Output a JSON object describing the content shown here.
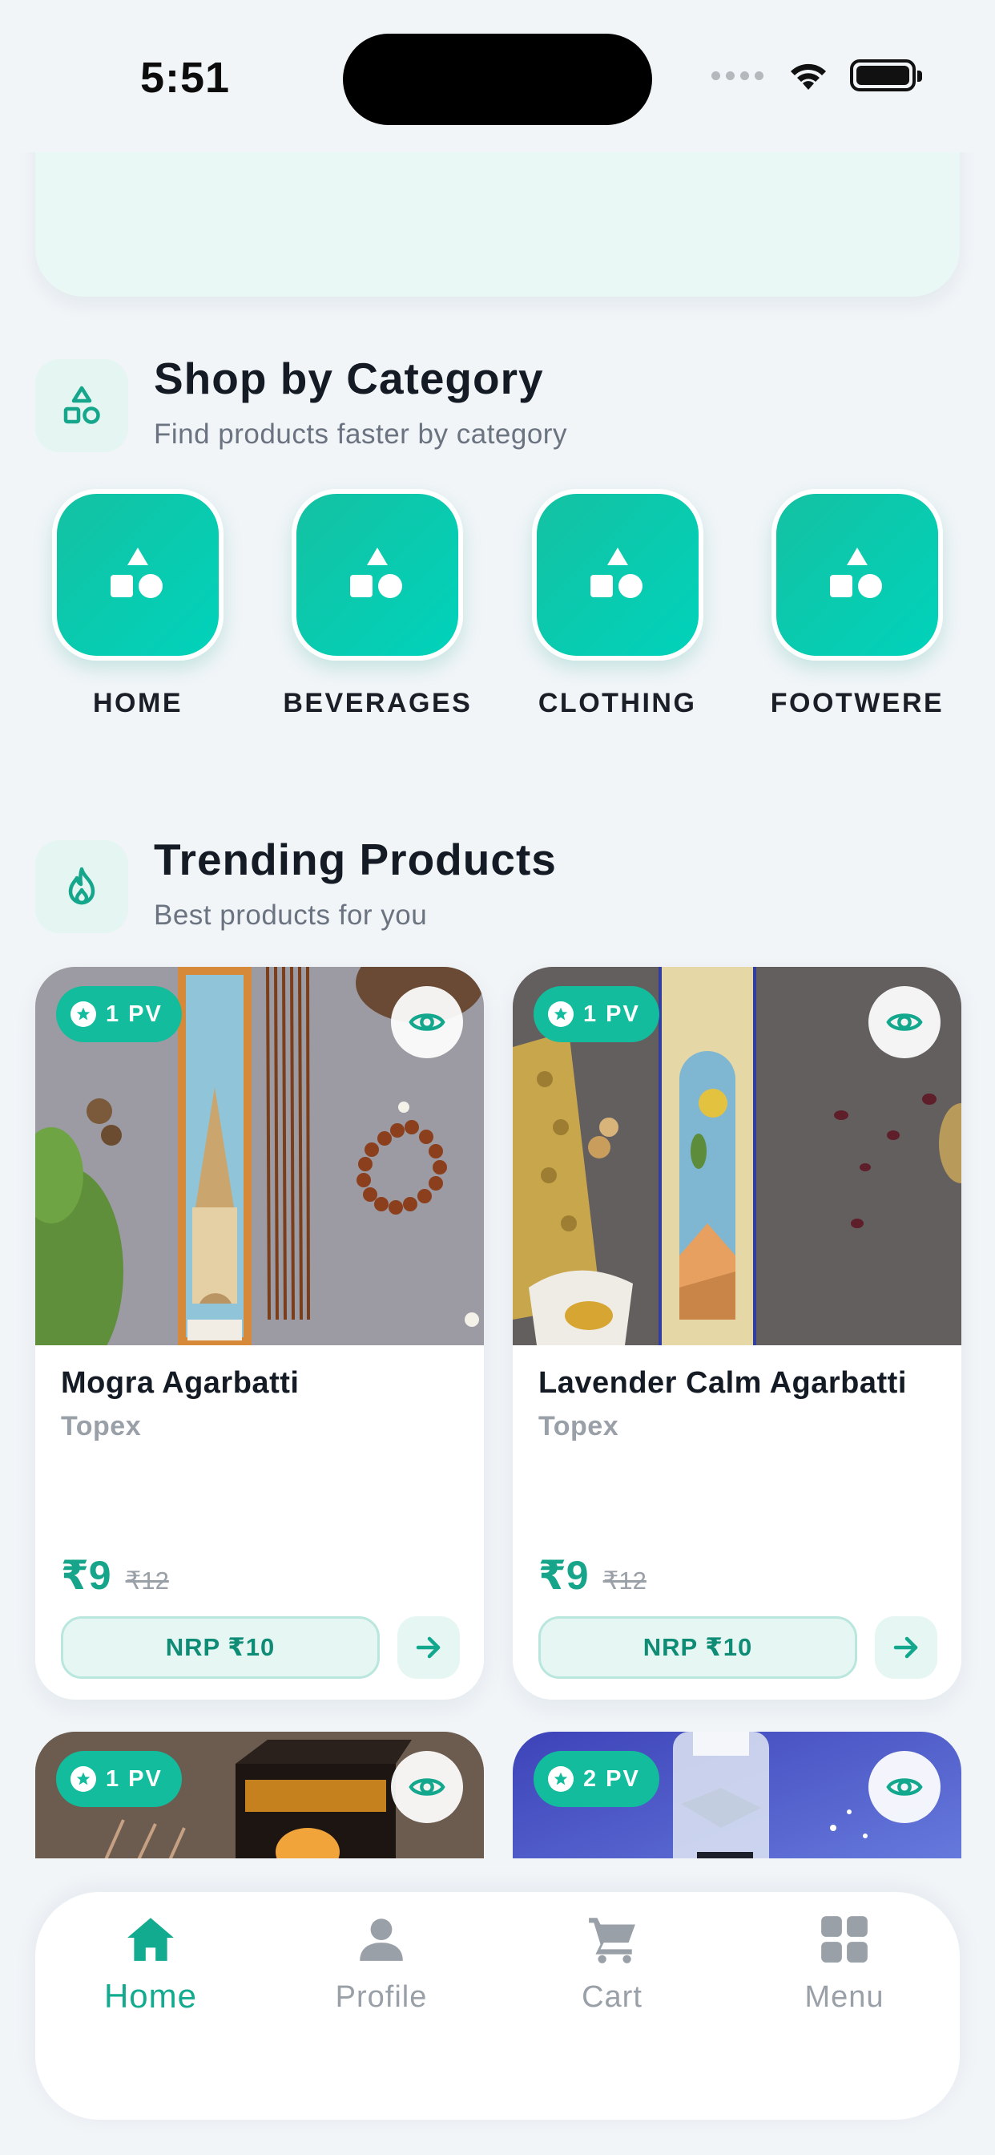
{
  "status_bar": {
    "time": "5:51"
  },
  "colors": {
    "accent": "#13bc9c",
    "accent_dark": "#16a58a",
    "inactive": "#9aa0a8",
    "background": "#f1f5f8"
  },
  "categories_section": {
    "title": "Shop by Category",
    "subtitle": "Find products faster by category",
    "icon": "shapes-icon",
    "items": [
      {
        "label": "HOME",
        "icon": "shapes-icon"
      },
      {
        "label": "BEVERAGES",
        "icon": "shapes-icon"
      },
      {
        "label": "CLOTHING",
        "icon": "shapes-icon"
      },
      {
        "label": "FOOTWERE",
        "icon": "shapes-icon"
      }
    ]
  },
  "trending_section": {
    "title": "Trending Products",
    "subtitle": "Best products for you",
    "icon": "flame-icon"
  },
  "products": [
    {
      "pv": "1 PV",
      "name": "Mogra Agarbatti",
      "brand": "Topex",
      "price": "₹9",
      "mrp": "₹12",
      "nrp": "NRP ₹10"
    },
    {
      "pv": "1 PV",
      "name": "Lavender Calm Agarbatti",
      "brand": "Topex",
      "price": "₹9",
      "mrp": "₹12",
      "nrp": "NRP ₹10"
    },
    {
      "pv": "1 PV"
    },
    {
      "pv": "2 PV"
    }
  ],
  "bottom_nav": {
    "items": [
      {
        "label": "Home",
        "icon": "home-icon",
        "active": true
      },
      {
        "label": "Profile",
        "icon": "person-icon",
        "active": false
      },
      {
        "label": "Cart",
        "icon": "cart-icon",
        "active": false
      },
      {
        "label": "Menu",
        "icon": "grid-icon",
        "active": false
      }
    ]
  }
}
